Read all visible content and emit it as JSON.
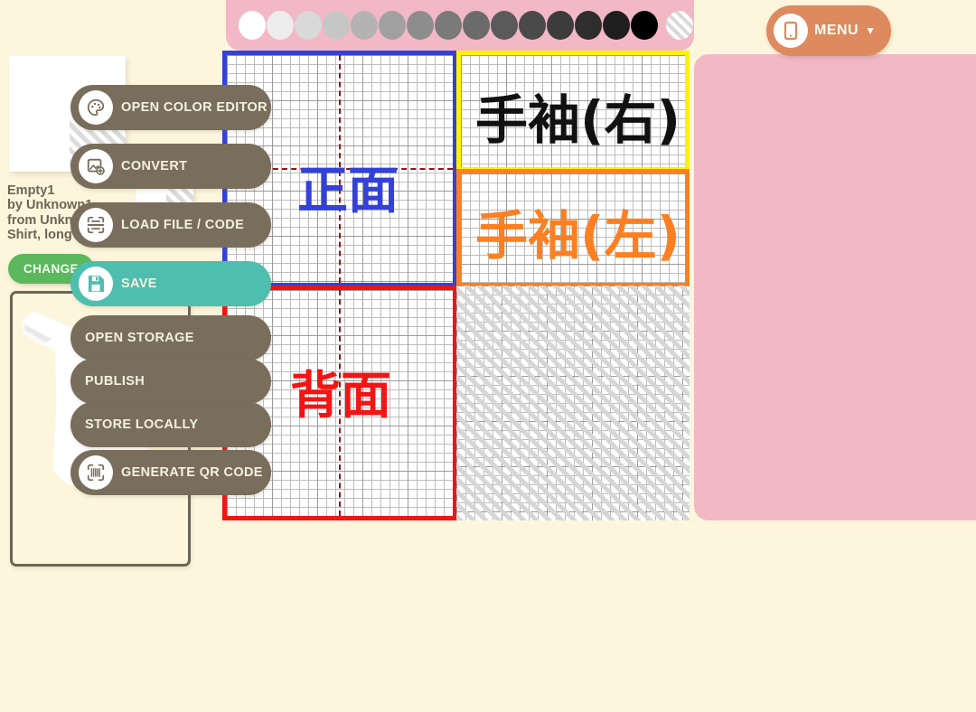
{
  "theme": {
    "background": "#fdf6dd",
    "panel_pink": "#f2b8c6",
    "button_brown": "#796d5b",
    "accent_teal": "#4ebfae",
    "accent_green": "#5cb85c",
    "accent_orange": "#dd8a5f"
  },
  "garment": {
    "name": "Empty1",
    "by": "by Unknown1",
    "from": "from Unknown1",
    "type": "Shirt, long sleeves",
    "change_label": "CHANGE"
  },
  "palette": {
    "name": "grayscale-palette",
    "swatches": [
      "#ffffff",
      "#ededed",
      "#d9d9d9",
      "#c6c6c6",
      "#b3b3b3",
      "#a0a0a0",
      "#8d8d8d",
      "#7a7a7a",
      "#6b6b6b",
      "#5a5a5a",
      "#4a4a4a",
      "#3c3c3c",
      "#2e2e2e",
      "#1f1f1f",
      "#000000"
    ],
    "transparent_label": "transparent"
  },
  "canvas": {
    "quadrants": [
      {
        "key": "front",
        "label": "正面",
        "color": "#3341d8",
        "crosshair": "both"
      },
      {
        "key": "right",
        "label": "手袖(右)",
        "color": "#fff200",
        "crosshair": "none"
      },
      {
        "key": "left",
        "label": "手袖(左)",
        "color": "#fb8022",
        "crosshair": "none"
      },
      {
        "key": "back",
        "label": "背面",
        "color": "#f31414",
        "crosshair": "vertical"
      },
      {
        "key": "disabled",
        "label": "",
        "color": "#d6d6d6",
        "crosshair": "none"
      }
    ]
  },
  "tools": [
    {
      "name": "pencil-tool",
      "icon": "pencil-icon",
      "active": true
    },
    {
      "name": "paint-bucket-tool",
      "icon": "paint-bucket-icon",
      "active": false
    },
    {
      "name": "eyedropper-tool",
      "icon": "eyedropper-icon",
      "active": false
    }
  ],
  "menu": {
    "label": "MENU",
    "caret": "▼",
    "icon": "device-icon"
  },
  "actions": [
    {
      "label": "OPEN COLOR EDITOR",
      "icon": "palette-icon",
      "style": "dark",
      "has_icon": true
    },
    {
      "label": "CONVERT",
      "icon": "image-add-icon",
      "style": "dark",
      "has_icon": true
    },
    {
      "label": "LOAD FILE / CODE",
      "icon": "scan-icon",
      "style": "dark",
      "has_icon": true
    },
    {
      "label": "SAVE",
      "icon": "floppy-icon",
      "style": "teal",
      "has_icon": true
    },
    {
      "label": "OPEN STORAGE",
      "icon": "",
      "style": "dark",
      "has_icon": false
    },
    {
      "label": "PUBLISH",
      "icon": "",
      "style": "dark",
      "has_icon": false
    },
    {
      "label": "STORE LOCALLY",
      "icon": "",
      "style": "dark",
      "has_icon": false
    },
    {
      "label": "GENERATE QR CODE",
      "icon": "qr-icon",
      "style": "dark",
      "has_icon": true
    }
  ]
}
